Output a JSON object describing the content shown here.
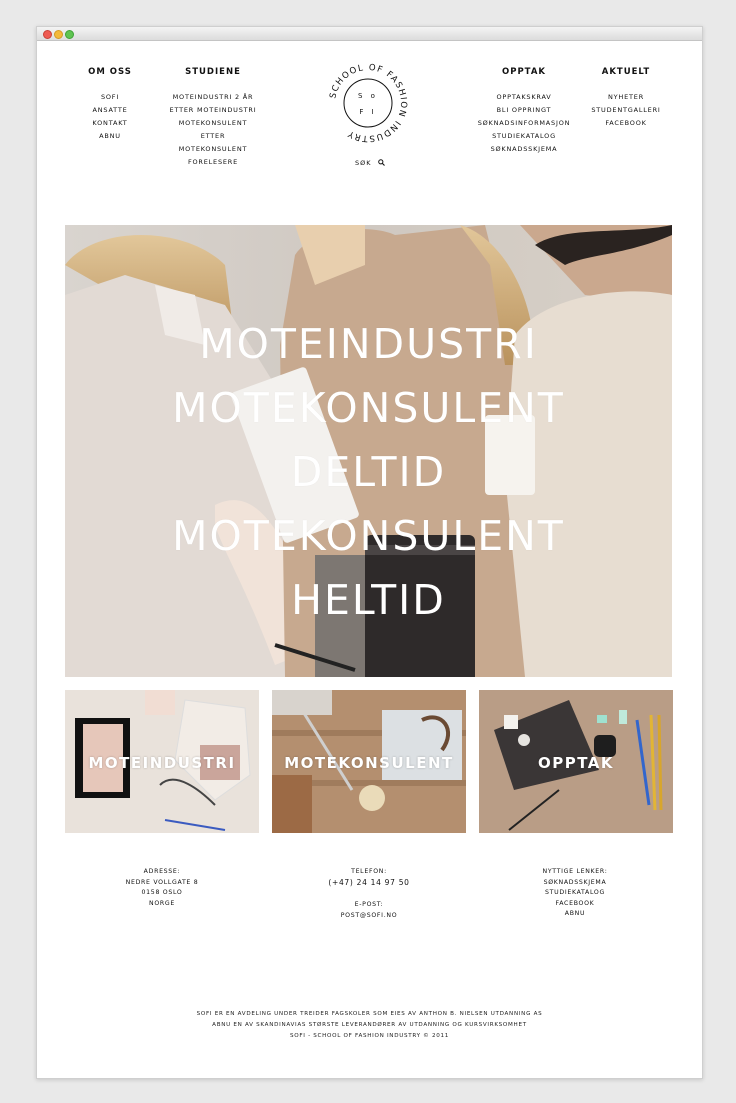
{
  "nav": {
    "om_oss": {
      "title": "OM OSS",
      "items": [
        "SOFI",
        "ANSATTE",
        "KONTAKT",
        "ABNU"
      ]
    },
    "studiene": {
      "title": "STUDIENE",
      "items": [
        "MOTEINDUSTRI 2 ÅR",
        "ETTER MOTEINDUSTRI",
        "MOTEKONSULENT",
        "ETTER",
        "MOTEKONSULENT",
        "FORELESERE"
      ]
    },
    "opptak": {
      "title": "OPPTAK",
      "items": [
        "OPPTAKSKRAV",
        "BLI OPPRINGT",
        "SØKNADSINFORMASJON",
        "STUDIEKATALOG",
        "SØKNADSSKJEMA"
      ]
    },
    "aktuelt": {
      "title": "AKTUELT",
      "items": [
        "NYHETER",
        "STUDENTGALLERI",
        "FACEBOOK"
      ]
    }
  },
  "logo": {
    "ring_text": "SCHOOL OF FASHION INDUSTRY",
    "center_top": "S o",
    "center_bottom": "F I"
  },
  "search": {
    "label": "SØK",
    "icon": "search-icon"
  },
  "hero": {
    "lines": [
      "MOTEINDUSTRI",
      "MOTEKONSULENT",
      "DELTID",
      "MOTEKONSULENT",
      "HELTID"
    ]
  },
  "tiles": [
    {
      "label": "MOTEINDUSTRI"
    },
    {
      "label": "MOTEKONSULENT"
    },
    {
      "label": "OPPTAK"
    }
  ],
  "footer": {
    "address": {
      "label": "ADRESSE:",
      "lines": [
        "NEDRE VOLLGATE 8",
        "0158 OSLO",
        "NORGE"
      ]
    },
    "phone": {
      "label": "TELEFON:",
      "value": "(+47) 24 14 97 50"
    },
    "email": {
      "label": "E-POST:",
      "value": "POST@SOFI.NO"
    },
    "links": {
      "label": "NYTTIGE LENKER:",
      "items": [
        "SØKNADSSKJEMA",
        "STUDIEKATALOG",
        "FACEBOOK",
        "ABNU"
      ]
    },
    "fine_print": [
      "SOFI ER EN AVDELING UNDER TREIDER FAGSKOLER SOM EIES AV ANTHON B. NIELSEN UTDANNING AS",
      "ABNU EN AV SKANDINAVIAS STØRSTE LEVERANDØRER AV UTDANNING OG KURSVIRKSOMHET",
      "SOFI - SCHOOL OF FASHION INDUSTRY © 2011"
    ]
  }
}
